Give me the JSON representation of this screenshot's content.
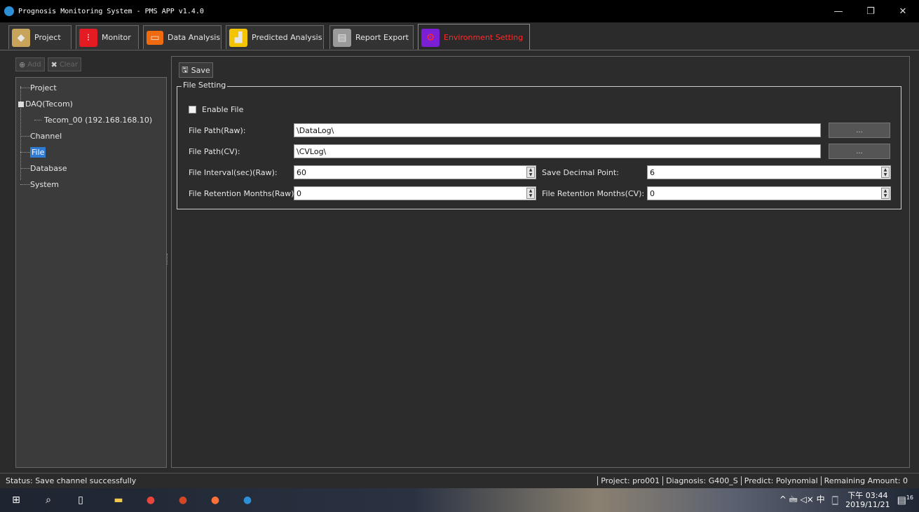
{
  "window": {
    "title": "Prognosis Monitoring System - PMS APP v1.4.0",
    "minimize": "—",
    "restore": "❐",
    "close": "✕"
  },
  "tabs": [
    {
      "label": "Project",
      "icon": "tag-icon"
    },
    {
      "label": "Monitor",
      "icon": "monitor-icon"
    },
    {
      "label": "Data Analysis",
      "icon": "data-analysis-icon"
    },
    {
      "label": "Predicted  Analysis",
      "icon": "predicted-analysis-icon"
    },
    {
      "label": "Report Export",
      "icon": "report-export-icon"
    },
    {
      "label": "Environment Setting",
      "icon": "environment-setting-icon",
      "active": true
    }
  ],
  "left_toolbar": {
    "add_label": "Add",
    "clear_label": "Clear"
  },
  "tree": {
    "items": [
      {
        "label": "Project"
      },
      {
        "label": "DAQ(Tecom)"
      },
      {
        "label": "Tecom_00 (192.168.168.10)"
      },
      {
        "label": "Channel"
      },
      {
        "label": "File",
        "selected": true
      },
      {
        "label": "Database"
      },
      {
        "label": "System"
      }
    ]
  },
  "main": {
    "save_label": "Save",
    "group_title": "File Setting",
    "enable_file_label": "Enable File",
    "file_path_raw_label": "File Path(Raw):",
    "file_path_raw_value": "\\DataLog\\",
    "file_path_cv_label": "File Path(CV):",
    "file_path_cv_value": "\\CVLog\\",
    "browse_label": "...",
    "file_interval_label": "File Interval(sec)(Raw):",
    "file_interval_value": "60",
    "save_decimal_label": "Save Decimal Point:",
    "save_decimal_value": "6",
    "retention_raw_label": "File Retention Months(Raw):",
    "retention_raw_value": "0",
    "retention_cv_label": "File Retention Months(CV):",
    "retention_cv_value": "0"
  },
  "status": {
    "left": "Status:  Save channel successfully",
    "project": "Project: pro001",
    "diagnosis": "Diagnosis: G400_S",
    "predict": "Predict: Polynomial",
    "remaining": "Remaining Amount: 0"
  },
  "taskbar": {
    "time": "下午 03:44",
    "date": "2019/11/21",
    "notifications": "16",
    "tray_text": "^ 🖮 ◁× 中"
  },
  "colors": {
    "active_tab_text": "#ff2a2a",
    "selection": "#2f7bd6"
  }
}
